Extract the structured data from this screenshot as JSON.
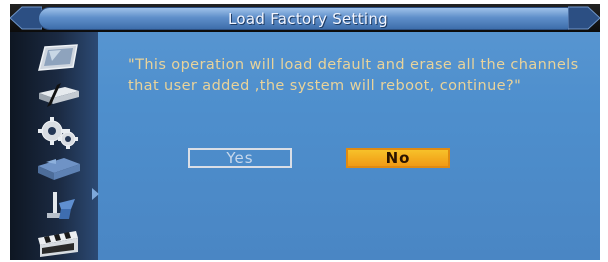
{
  "window": {
    "title": "Load Factory Setting"
  },
  "dialog": {
    "message": "\"This operation will load default and erase all the channels that user added ,the system will reboot, continue?\"",
    "yes_label": "Yes",
    "no_label": "No",
    "selected": "No"
  },
  "sidebar": {
    "items": [
      {
        "icon": "tv-screen-icon"
      },
      {
        "icon": "set-top-box-icon"
      },
      {
        "icon": "gears-icon"
      },
      {
        "icon": "satellite-dish-icon"
      },
      {
        "icon": "tools-icon"
      },
      {
        "icon": "clapperboard-icon"
      }
    ],
    "active_index": 3
  },
  "colors": {
    "background": "#4e8fcd",
    "message_text": "#e9d39a",
    "selected_button": "#f09a14",
    "title_bar": "#5f8fca"
  }
}
